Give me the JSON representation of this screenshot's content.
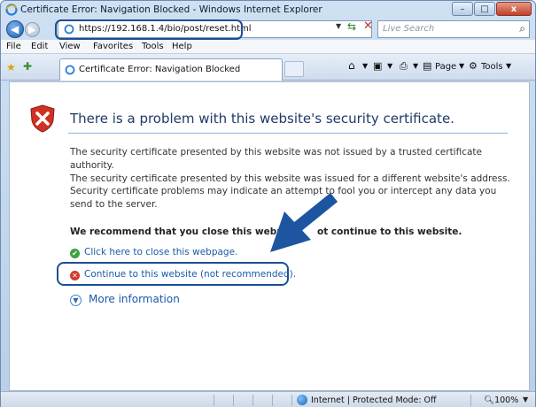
{
  "window": {
    "title": "Certificate Error: Navigation Blocked - Windows Internet Explorer",
    "minimize": "–",
    "maximize": "□",
    "close": "x"
  },
  "address": {
    "url": "https://192.168.1.4/bio/post/reset.html",
    "refresh_icon": "refresh-icon",
    "stop_icon": "stop-icon"
  },
  "search": {
    "placeholder": "Live Search"
  },
  "menu": {
    "items": [
      "File",
      "Edit",
      "View",
      "Favorites",
      "Tools",
      "Help"
    ]
  },
  "tab": {
    "label": "Certificate Error: Navigation Blocked"
  },
  "toolbar": {
    "page_label": "Page",
    "tools_label": "Tools"
  },
  "content": {
    "headline": "There is a problem with this website's security certificate.",
    "para1_line1": "The security certificate presented by this website was not issued by a trusted certificate authority.",
    "para1_line2": "The security certificate presented by this website was issued for a different website's address.",
    "para2": "Security certificate problems may indicate an attempt to fool you or intercept any data you send to the server.",
    "recommend_left": "We recommend that you close this webpage",
    "recommend_right": "ot continue to this website.",
    "close_link": "Click here to close this webpage.",
    "continue_link": "Continue to this website (not recommended).",
    "more_info": "More information"
  },
  "status": {
    "zone": "Internet | Protected Mode: Off",
    "zoom": "100%"
  },
  "colors": {
    "accent_callout": "#1d4f91",
    "link": "#1a5aa8",
    "headline": "#1f3a68"
  }
}
